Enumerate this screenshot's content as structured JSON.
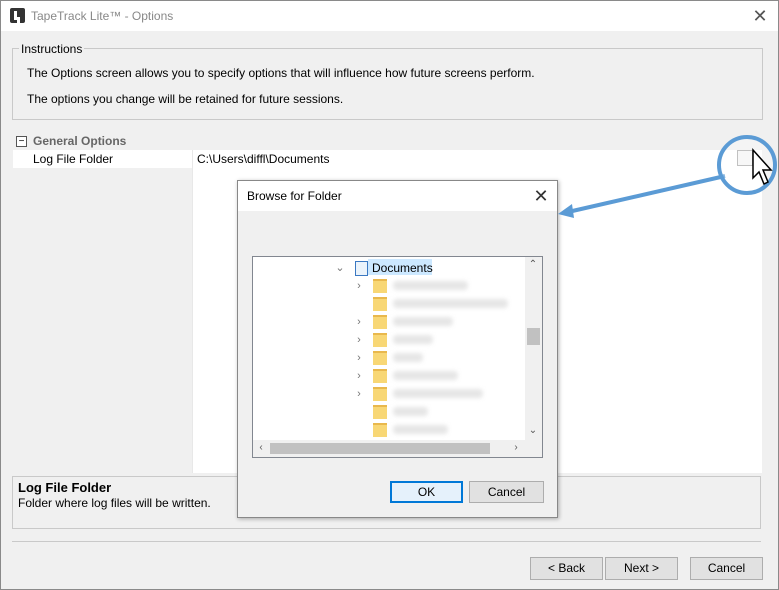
{
  "window": {
    "title": "TapeTrack Lite™ - Options"
  },
  "instructions": {
    "legend": "Instructions",
    "line1": "The Options screen allows you to specify options that will influence how future screens perform.",
    "line2": "The options you change will be retained for future sessions."
  },
  "property_grid": {
    "category": "General Options",
    "properties": [
      {
        "name": "Log File Folder",
        "value": "C:\\Users\\diffl\\Documents"
      }
    ]
  },
  "description": {
    "title": "Log File Folder",
    "text": "Folder where log files will be written."
  },
  "buttons": {
    "back": "< Back",
    "next": "Next >",
    "cancel": "Cancel"
  },
  "dialog": {
    "title": "Browse for Folder",
    "selected_folder": "Documents",
    "ok": "OK",
    "cancel": "Cancel"
  },
  "colors": {
    "callout": "#5b9bd5",
    "selection": "#cce8ff",
    "folder": "#f8d775"
  }
}
